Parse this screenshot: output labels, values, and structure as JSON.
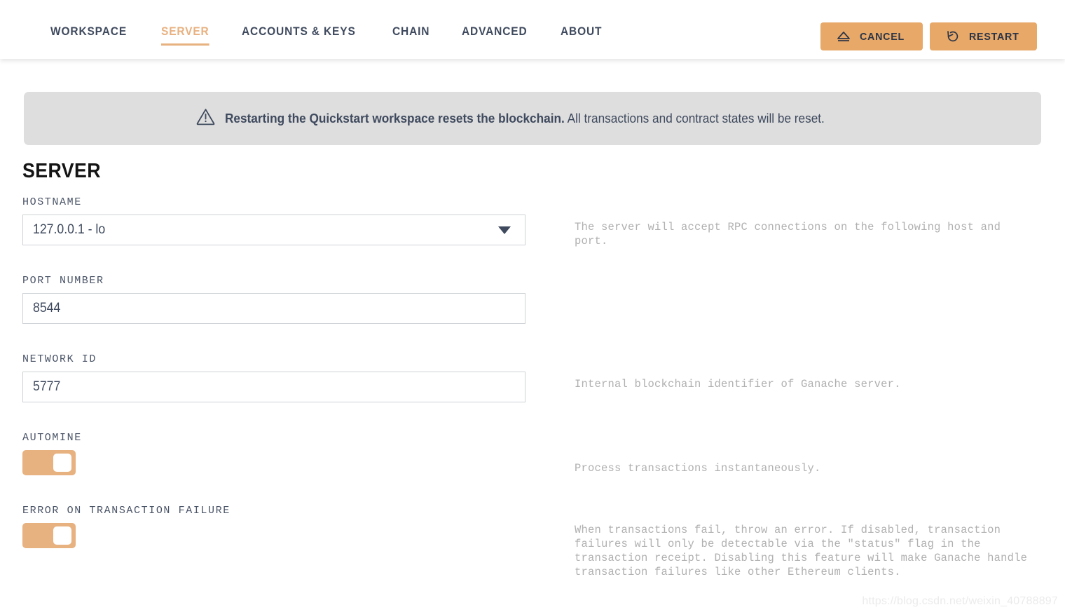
{
  "header": {
    "tabs": [
      {
        "label": "WORKSPACE",
        "active": false
      },
      {
        "label": "SERVER",
        "active": true
      },
      {
        "label": "ACCOUNTS & KEYS",
        "active": false
      },
      {
        "label": "CHAIN",
        "active": false
      },
      {
        "label": "ADVANCED",
        "active": false
      },
      {
        "label": "ABOUT",
        "active": false
      }
    ],
    "cancel_label": "CANCEL",
    "cancel_icon": "eject-icon",
    "restart_label": "RESTART",
    "restart_icon": "restart-icon",
    "button_color": "#e8a868"
  },
  "banner": {
    "icon": "warning-triangle-icon",
    "bold_text": "Restarting the Quickstart workspace resets the blockchain.",
    "text": "All transactions and contract states will be reset.",
    "background": "#dedede"
  },
  "page": {
    "title": "SERVER"
  },
  "fields": {
    "hostname": {
      "label": "HOSTNAME",
      "value": "127.0.0.1 - lo",
      "description": "The server will accept RPC connections on the following host and port."
    },
    "port": {
      "label": "PORT NUMBER",
      "value": "8544",
      "description": ""
    },
    "network_id": {
      "label": "NETWORK ID",
      "value": "5777",
      "description": "Internal blockchain identifier of Ganache server."
    },
    "automine": {
      "label": "AUTOMINE",
      "state": "on",
      "description": "Process transactions instantaneously."
    },
    "error_on_failure": {
      "label": "ERROR ON TRANSACTION FAILURE",
      "state": "on",
      "description": "When transactions fail, throw an error. If disabled, transaction failures will only be detectable via the \"status\" flag in the transaction receipt. Disabling this feature will make Ganache handle transaction failures like other Ethereum clients."
    }
  },
  "watermark": {
    "text": "https://blog.csdn.net/weixin_40788897"
  },
  "colors": {
    "accent": "#e8b180",
    "button": "#e8a868",
    "text": "#3f4a5e",
    "muted": "#b0b0b0"
  }
}
